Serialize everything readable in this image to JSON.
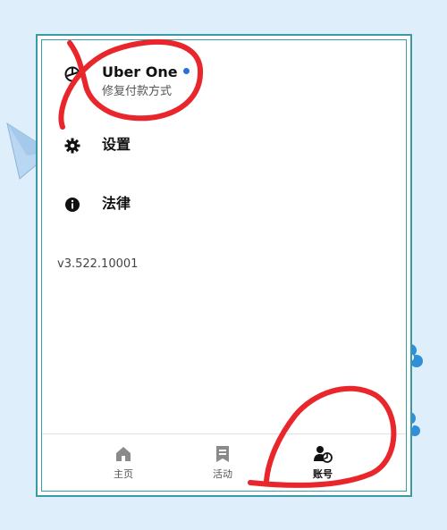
{
  "menu": {
    "uber_one": {
      "title": "Uber One",
      "subtitle": "修复付款方式"
    },
    "settings": {
      "title": "设置"
    },
    "legal": {
      "title": "法律"
    }
  },
  "version": "v3.522.10001",
  "tabs": [
    {
      "label": "主页",
      "icon": "home-icon",
      "active": false
    },
    {
      "label": "活动",
      "icon": "receipt-icon",
      "active": false
    },
    {
      "label": "账号",
      "icon": "account-icon",
      "active": true
    }
  ],
  "colors": {
    "background": "#deeefa",
    "frame": "#3a9aa6",
    "notification_dot": "#2c6fd8",
    "annotation": "#e8262b"
  }
}
